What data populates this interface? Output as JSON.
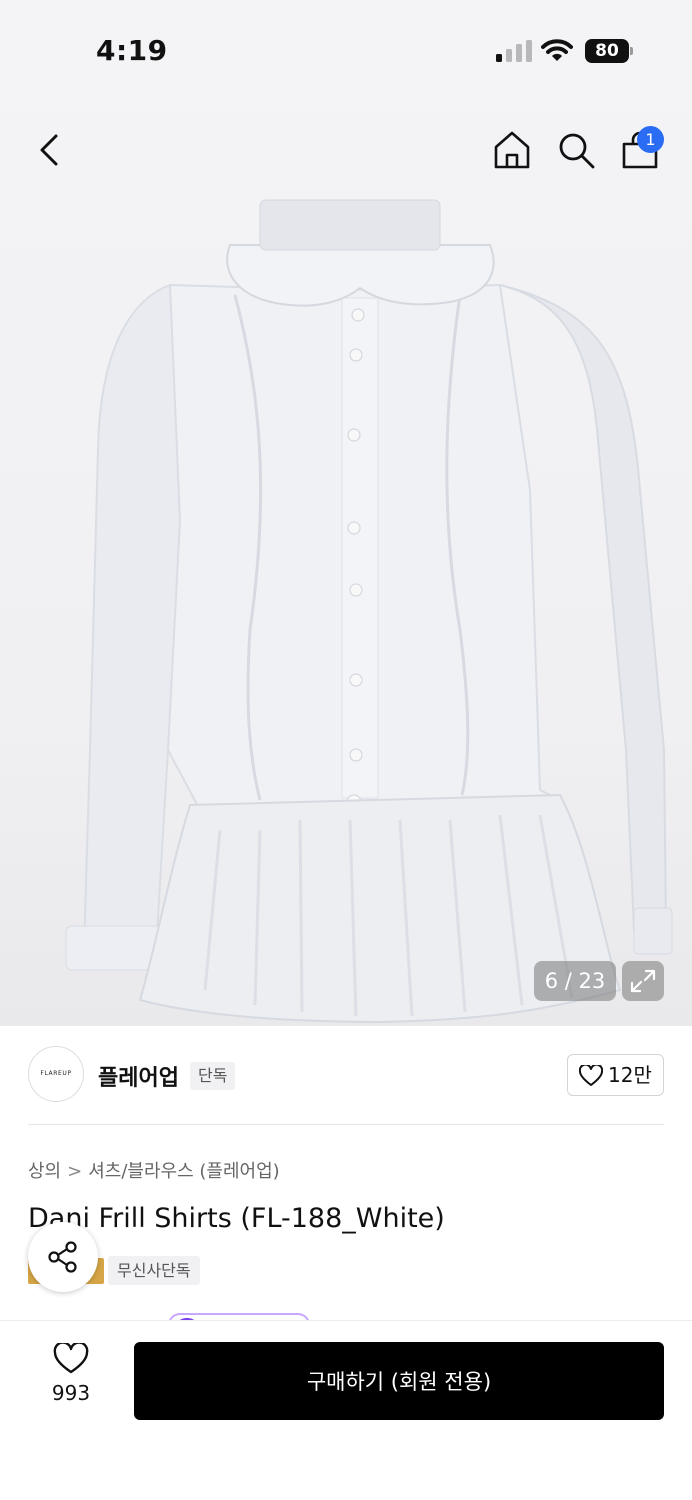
{
  "status_bar": {
    "time": "4:19",
    "battery": "80"
  },
  "nav": {
    "cart_count": "1"
  },
  "gallery": {
    "counter": "6 / 23"
  },
  "brand": {
    "logo_text": "FLAREUP",
    "name": "플레어업",
    "tag": "단독",
    "likes": "12만"
  },
  "breadcrumb": {
    "category": "상의",
    "separator": ">",
    "subcategory": "셔츠/블라우스 (플레어업)"
  },
  "product": {
    "title": "Dani Frill Shirts (FL-188_White)",
    "exclusive_tag": "무신사단독"
  },
  "bottom_bar": {
    "wish_count": "993",
    "buy_label": "구매하기 (회원 전용)"
  },
  "colors": {
    "badge_blue": "#2a6df4",
    "gold_tag": "#d6a646",
    "buy_button": "#000000",
    "accent_purple": "#7b3ff2"
  },
  "icons": [
    "back-icon",
    "home-icon",
    "search-icon",
    "shopping-bag-icon",
    "expand-icon",
    "heart-icon",
    "share-icon"
  ]
}
